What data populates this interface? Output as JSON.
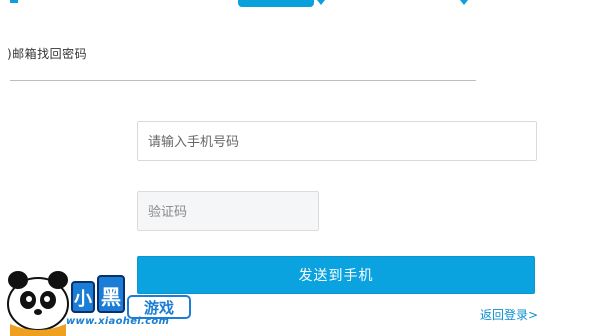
{
  "page": {
    "heading": ")邮箱找回密码"
  },
  "form": {
    "phone_placeholder": "请输入手机号码",
    "code_placeholder": "验证码",
    "send_label": "发送到手机"
  },
  "footer": {
    "back_link": "返回登录>"
  },
  "watermark": {
    "site": "www.xiaohei.com",
    "logo_text": "小黑游戏"
  },
  "colors": {
    "accent": "#0aa3e0",
    "link": "#0a8fd0"
  }
}
